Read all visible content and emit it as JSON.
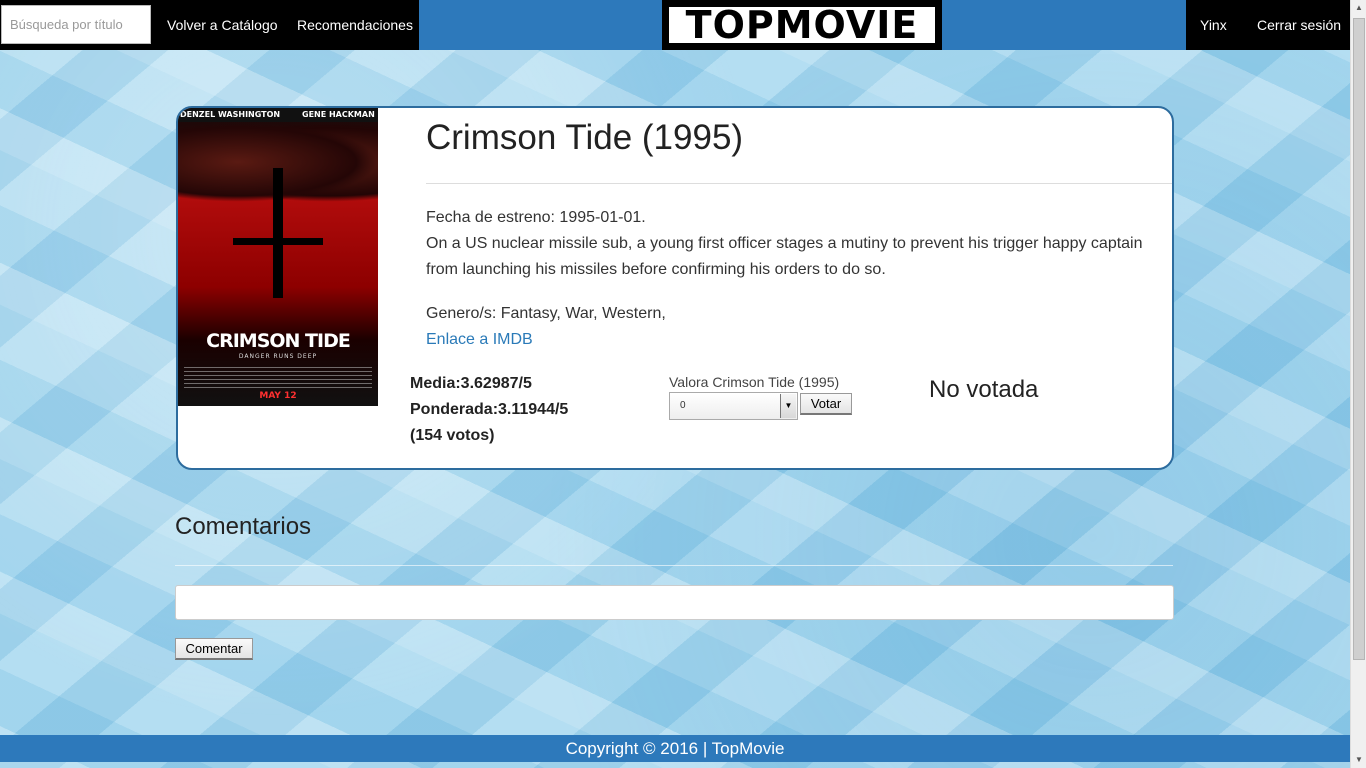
{
  "nav": {
    "search_placeholder": "Búsqueda por título",
    "catalog_link": "Volver a Catálogo",
    "recommendations_link": "Recomendaciones",
    "logo_text": "TOPMOVIE",
    "user_link": "Yinx",
    "logout_link": "Cerrar sesión"
  },
  "poster": {
    "actor_left": "DENZEL WASHINGTON",
    "actor_right": "GENE HACKMAN",
    "title": "CRIMSON TIDE",
    "tagline": "DANGER RUNS DEEP",
    "date": "MAY 12"
  },
  "movie": {
    "title": "Crimson Tide (1995)",
    "release": "Fecha de estreno: 1995-01-01.",
    "synopsis": "On a US nuclear missile sub, a young first officer stages a mutiny to prevent his trigger happy captain from launching his missiles before confirming his orders to do so.",
    "genres": "Genero/s: Fantasy, War, Western,",
    "imdb_link": "Enlace a IMDB"
  },
  "stats": {
    "average": "Media:3.62987/5",
    "weighted": "Ponderada:3.11944/5",
    "votes": "(154 votos)"
  },
  "rating": {
    "label": "Valora Crimson Tide (1995)",
    "selected_value": "0",
    "vote_button": "Votar",
    "status": "No votada"
  },
  "comments": {
    "heading": "Comentarios",
    "input_value": "",
    "submit_button": "Comentar"
  },
  "footer": {
    "copyright": "Copyright © 2016 | TopMovie"
  },
  "colors": {
    "nav_blue": "#2d79bb",
    "card_border": "#2d6c9e",
    "link_blue": "#2a7ab8"
  }
}
